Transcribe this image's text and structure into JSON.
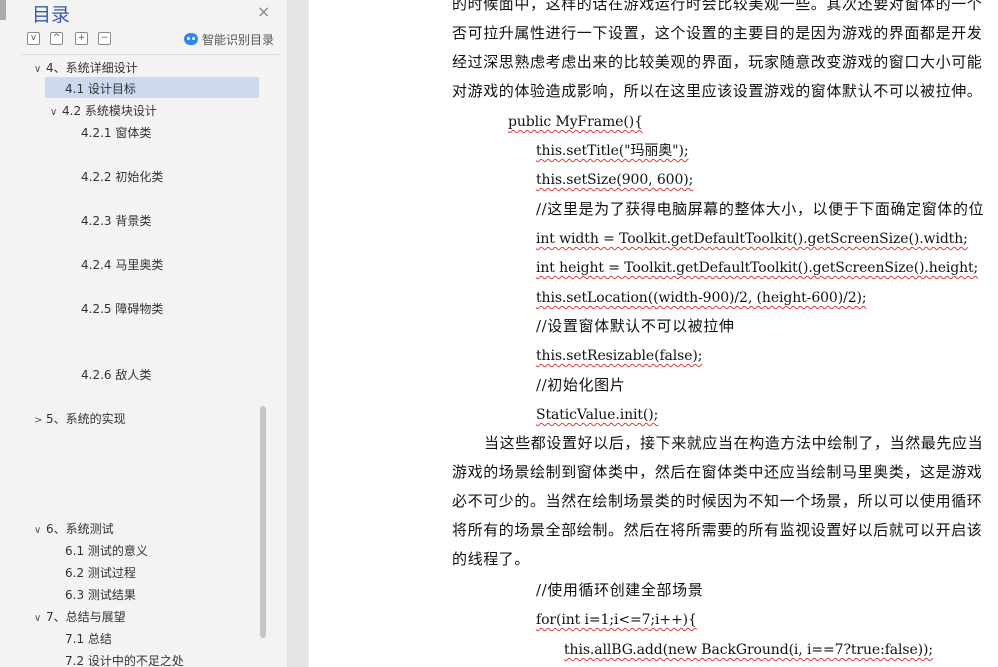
{
  "nav": {
    "title": "目录",
    "close_symbol": "×",
    "toolbar": {
      "collapse_all": "−",
      "expand_all": "+",
      "prev": "^",
      "next": "v"
    },
    "smart_toc_label": "智能识别目录",
    "items": [
      {
        "label": "4、系统详细设计",
        "arrow": "∨"
      },
      {
        "label": "4.1  设计目标",
        "arrow": ""
      },
      {
        "label": "4.2  系统模块设计",
        "arrow": "∨"
      },
      {
        "label": "4.2.1 窗体类",
        "arrow": ""
      },
      {
        "label": "4.2.2 初始化类",
        "arrow": ""
      },
      {
        "label": "4.2.3 背景类",
        "arrow": ""
      },
      {
        "label": "4.2.4 马里奥类",
        "arrow": ""
      },
      {
        "label": "4.2.5 障碍物类",
        "arrow": ""
      },
      {
        "label": "4.2.6 敌人类",
        "arrow": ""
      },
      {
        "label": "5、系统的实现",
        "arrow": ">"
      },
      {
        "label": "6、系统测试",
        "arrow": "∨"
      },
      {
        "label": "6.1  测试的意义",
        "arrow": ""
      },
      {
        "label": "6.2  测试过程",
        "arrow": ""
      },
      {
        "label": "6.3  测试结果",
        "arrow": ""
      },
      {
        "label": "7、总结与展望",
        "arrow": "∨"
      },
      {
        "label": "7.1  总结",
        "arrow": ""
      },
      {
        "label": "7.2  设计中的不足之处",
        "arrow": ""
      }
    ]
  },
  "document": {
    "lines": [
      "的时候面中，这样的话在游戏运行时会比较美观一些。其次还要对窗体的一个",
      "否可拉升属性进行一下设置，这个设置的主要目的是因为游戏的界面都是开发",
      "经过深思熟虑考虑出来的比较美观的界面，玩家随意改变游戏的窗口大小可能",
      "对游戏的体验造成影响，所以在这里应该设置游戏的窗体默认不可以被拉伸。",
      "public MyFrame(){",
      "this.setTitle(\"玛丽奥\");",
      "this.setSize(900, 600);",
      " //这里是为了获得电脑屏幕的整体大小，以便于下面确定窗体的位",
      "int width = Toolkit.getDefaultToolkit().getScreenSize().width;",
      "int height = Toolkit.getDefaultToolkit().getScreenSize().height;",
      "this.setLocation((width-900)/2, (height-600)/2);",
      " //设置窗体默认不可以被拉伸",
      "this.setResizable(false);",
      "//初始化图片",
      "StaticValue.init();",
      "当这些都设置好以后，接下来就应当在构造方法中绘制了，当然最先应当",
      "游戏的场景绘制到窗体类中，然后在窗体类中还应当绘制马里奥类，这是游戏",
      "必不可少的。当然在绘制场景类的时候因为不知一个场景，所以可以使用循环",
      "将所有的场景全部绘制。然后在将所需要的所有监视设置好以后就可以开启该",
      "的线程了。",
      "//使用循环创建全部场景",
      "for(int i=1;i<=7;i++){",
      "this.allBG.add(new BackGround(i, i==7?true:false));"
    ]
  },
  "colors": {
    "nav_background": "#f3f3f3",
    "nav_selected": "#cdd9ef",
    "nav_title": "#3a5aa8",
    "smart_icon": "#2f86f6",
    "spellcheck_underline": "#d23b3b",
    "page": "#ffffff"
  }
}
